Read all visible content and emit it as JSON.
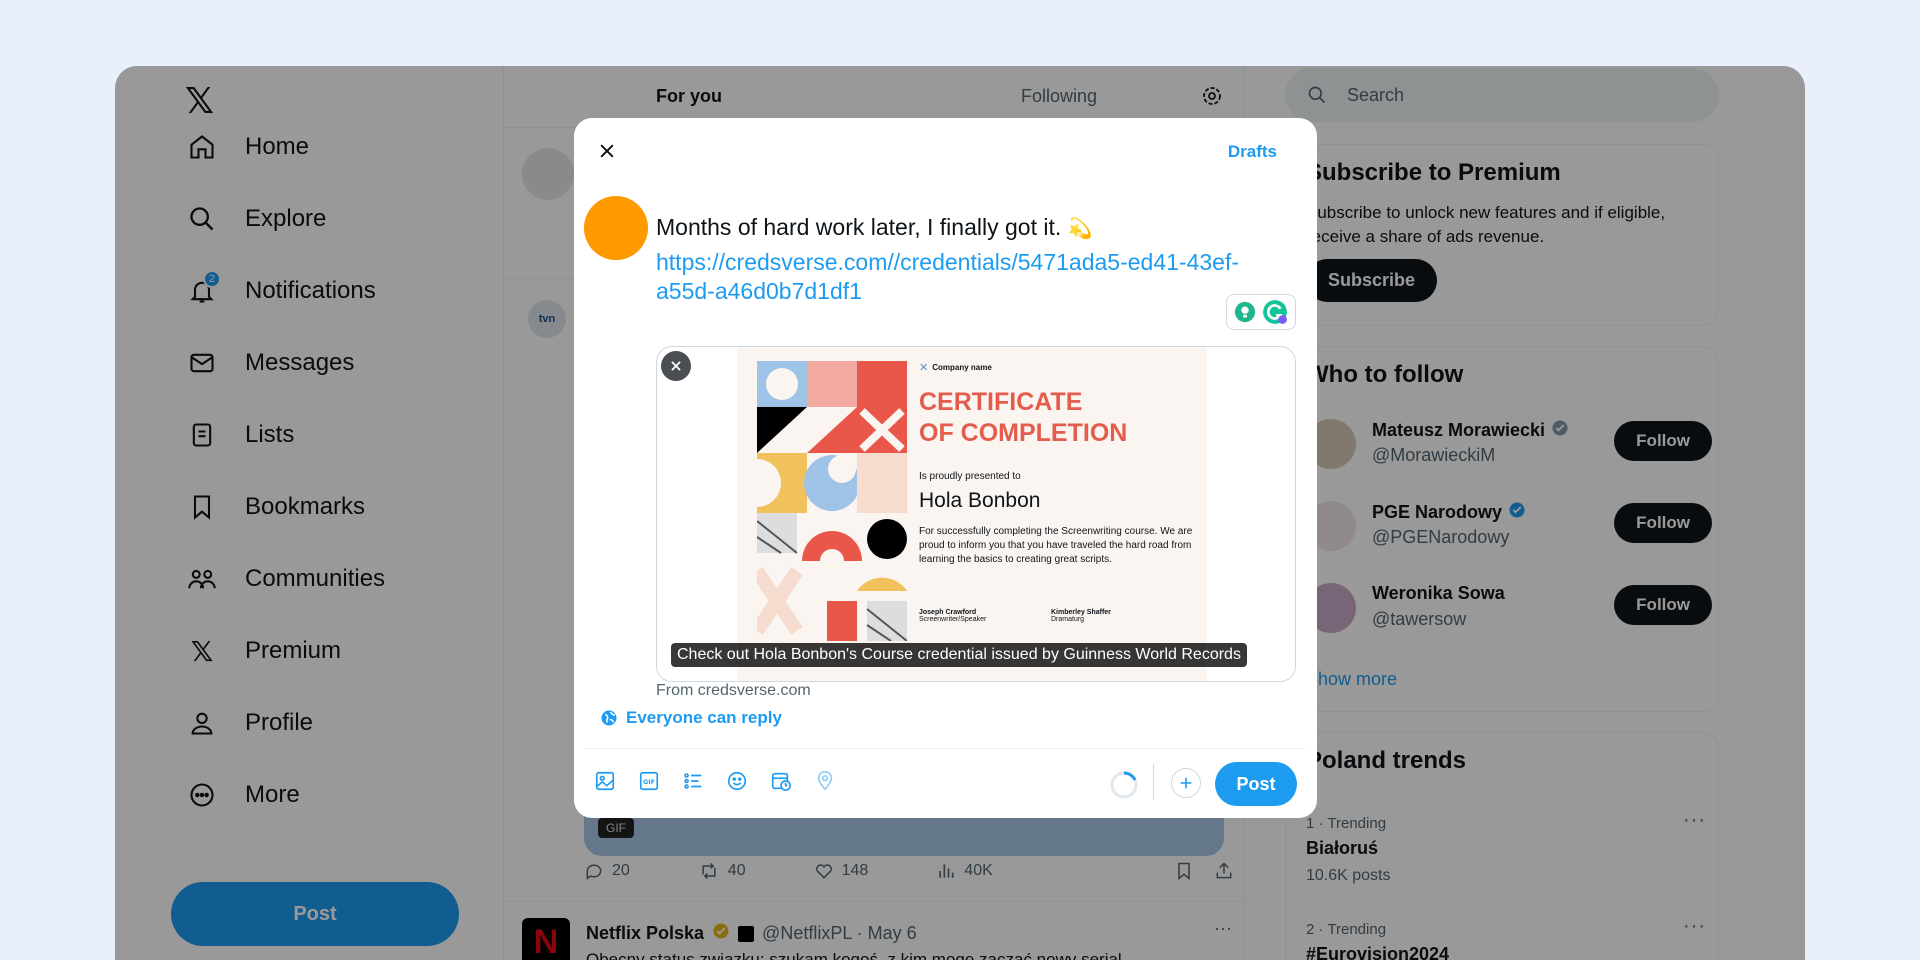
{
  "nav": {
    "logo": "𝕏",
    "items": [
      {
        "label": "Home",
        "icon": "home-icon"
      },
      {
        "label": "Explore",
        "icon": "search-icon"
      },
      {
        "label": "Notifications",
        "icon": "bell-icon",
        "badge": "2"
      },
      {
        "label": "Messages",
        "icon": "envelope-icon"
      },
      {
        "label": "Lists",
        "icon": "list-icon"
      },
      {
        "label": "Bookmarks",
        "icon": "bookmark-icon"
      },
      {
        "label": "Communities",
        "icon": "people-icon"
      },
      {
        "label": "Premium",
        "icon": "x-logo-icon"
      },
      {
        "label": "Profile",
        "icon": "person-icon"
      },
      {
        "label": "More",
        "icon": "more-circle-icon"
      }
    ],
    "post_label": "Post"
  },
  "feed": {
    "tabs": [
      "For you",
      "Following"
    ],
    "tvn_label": "tvn",
    "gif_label": "GIF",
    "actions": {
      "replies": "20",
      "reposts": "40",
      "likes": "148",
      "views": "40K"
    },
    "tweet2": {
      "name": "Netflix Polska",
      "handle": "@NetflixPL · May 6",
      "text": "Obecny status związku: szukam kogoś, z kim mogę zacząć nowy serial",
      "more": "···",
      "avatar_letter": "N"
    }
  },
  "sidebar": {
    "search_placeholder": "Search",
    "premium": {
      "title": "Subscribe to Premium",
      "text": "Subscribe to unlock new features and if eligible, receive a share of ads revenue.",
      "button": "Subscribe"
    },
    "who_to_follow": {
      "title": "Who to follow",
      "follow_label": "Follow",
      "users": [
        {
          "name": "Mateusz Morawiecki",
          "handle": "@MorawieckiM",
          "verified": "grey"
        },
        {
          "name": "PGE Narodowy",
          "handle": "@PGENarodowy",
          "verified": "blue"
        },
        {
          "name": "Weronika Sowa",
          "handle": "@tawersow",
          "verified": ""
        }
      ],
      "show_more": "Show more"
    },
    "trends": {
      "title": "Poland trends",
      "items": [
        {
          "meta": "1 · Trending",
          "title": "Białoruś",
          "count": "10.6K posts"
        },
        {
          "meta": "2 · Trending",
          "title": "#Eurovision2024",
          "count": ""
        }
      ],
      "more": "···"
    }
  },
  "modal": {
    "drafts_label": "Drafts",
    "text": "Months of hard work later, I finally got it.",
    "emoji": "💫",
    "link": "https://credsverse.com//credentials/5471ada5-ed41-43ef-a55d-a46d0b7d1df1",
    "card": {
      "company": "Company name",
      "title_line1": "CERTIFICATE",
      "title_line2": "OF COMPLETION",
      "presented": "Is proudly presented to",
      "recipient": "Hola Bonbon",
      "description": "For successfully completing the Screenwriting course. We are proud to inform you that you have traveled the hard road from learning the basics to creating great scripts.",
      "signer1_name": "Joseph Crawford",
      "signer1_role": "Screenwriter/Speaker",
      "signer2_name": "Kimberley Shaffer",
      "signer2_role": "Dramaturg",
      "caption": "Check out Hola Bonbon's Course credential issued by Guinness World Records"
    },
    "from": "From credsverse.com",
    "reply_setting": "Everyone can reply",
    "post_label": "Post",
    "accent_color": "#1d9bf0"
  }
}
